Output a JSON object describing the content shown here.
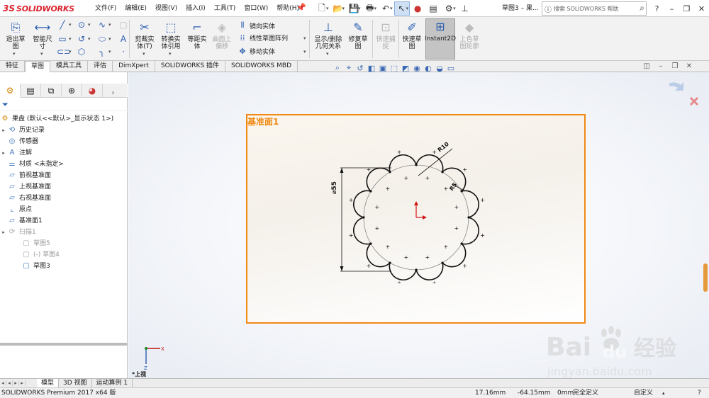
{
  "app": {
    "logo_ds": "3S",
    "logo_text": "SOLIDWORKS",
    "menus": [
      "文件(F)",
      "编辑(E)",
      "视图(V)",
      "插入(I)",
      "工具(T)",
      "窗口(W)",
      "帮助(H)"
    ],
    "doc_title": "草图3 – 果...",
    "search_placeholder": "搜索 SOLIDWORKS 帮助"
  },
  "ribbon": {
    "exit_sketch": "退出草\n图",
    "smart_dim": "智能尺\n寸",
    "trim": "剪裁实\n体(T)",
    "convert": "转换实\n体引用",
    "offset": "等距实\n体",
    "surface_offset": "曲面上\n偏移",
    "mirror": "镜向实体",
    "linear_pattern": "线性草图阵列",
    "move": "移动实体",
    "relations": "显示/删除\n几何关系",
    "repair": "修复草\n图",
    "quick_snap": "快速捕\n捉",
    "rapid_sketch": "快速草\n图",
    "instant2d": "Instant2D",
    "shaded_contours": "上色草\n图轮廓"
  },
  "tabs": [
    "特征",
    "草图",
    "模具工具",
    "评估",
    "DimXpert",
    "SOLIDWORKS 插件",
    "SOLIDWORKS MBD"
  ],
  "active_tab": "草图",
  "tree": {
    "root": "果盘  (默认<<默认>_显示状态 1>)",
    "items": [
      {
        "label": "历史记录",
        "icon": "history-icon",
        "expand": true
      },
      {
        "label": "传感器",
        "icon": "sensor-icon",
        "expand": false
      },
      {
        "label": "注解",
        "icon": "annotation-icon",
        "expand": true
      },
      {
        "label": "材质 <未指定>",
        "icon": "material-icon",
        "expand": false
      },
      {
        "label": "前视基准面",
        "icon": "plane-icon",
        "expand": false
      },
      {
        "label": "上视基准面",
        "icon": "plane-icon",
        "expand": false
      },
      {
        "label": "右视基准面",
        "icon": "plane-icon",
        "expand": false
      },
      {
        "label": "原点",
        "icon": "origin-icon",
        "expand": false
      },
      {
        "label": "基准面1",
        "icon": "plane-icon",
        "expand": false
      },
      {
        "label": "扫描1",
        "icon": "sweep-icon",
        "expand": true,
        "grey": true
      },
      {
        "label": "草图5",
        "icon": "sketch-icon",
        "indent": 1,
        "grey": true
      },
      {
        "label": "(-) 草图4",
        "icon": "sketch-icon",
        "indent": 1,
        "grey": true
      },
      {
        "label": "草图3",
        "icon": "sketch-icon",
        "indent": 1,
        "grey": false
      }
    ]
  },
  "graphics": {
    "plane_label": "基准面1",
    "dim_diameter": "⌀55",
    "dim_radius_1": "R10",
    "dim_radius_2": "R5",
    "view_label": "*上视",
    "watermark_main": "Bai",
    "watermark_du": "du",
    "watermark_cn": "经验",
    "watermark_url": "jingyan.baidu.com"
  },
  "bottom_tabs": [
    "模型",
    "3D 视图",
    "运动算例 1"
  ],
  "active_bottom_tab": "模型",
  "status": {
    "product": "SOLIDWORKS Premium 2017 x64 版",
    "x": "17.16mm",
    "y": "-64.15mm",
    "z": "0mm",
    "state": "完全定义",
    "units": "自定义"
  }
}
